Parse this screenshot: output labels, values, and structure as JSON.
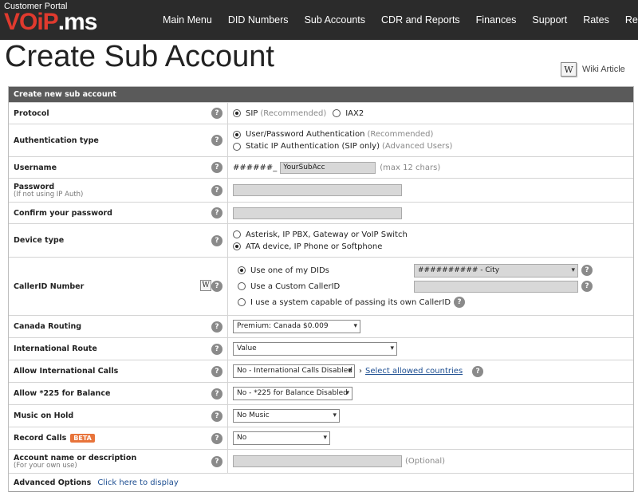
{
  "header": {
    "portal_label": "Customer Portal",
    "logo_voip": "VOiP",
    "logo_ms": ".ms",
    "nav": [
      "Main Menu",
      "DID Numbers",
      "Sub Accounts",
      "CDR and Reports",
      "Finances",
      "Support",
      "Rates",
      "Reseller"
    ]
  },
  "page": {
    "title": "Create Sub Account",
    "wiki_badge": "W",
    "wiki_text": "Wiki Article"
  },
  "form": {
    "heading": "Create new sub account",
    "help_glyph": "?",
    "protocol": {
      "label": "Protocol",
      "sip": "SIP",
      "sip_note": "(Recommended)",
      "iax": "IAX2"
    },
    "auth": {
      "label": "Authentication type",
      "opt1": "User/Password Authentication",
      "opt1_note": "(Recommended)",
      "opt2": "Static IP Authentication (SIP only)",
      "opt2_note": "(Advanced Users)"
    },
    "username": {
      "label": "Username",
      "prefix": "######_",
      "value": "YourSubAcc",
      "hint": "(max 12 chars)"
    },
    "password": {
      "label": "Password",
      "sub": "(If not using IP Auth)",
      "value": ""
    },
    "confirm": {
      "label": "Confirm your password",
      "value": ""
    },
    "device": {
      "label": "Device type",
      "opt1": "Asterisk, IP PBX, Gateway or VoIP Switch",
      "opt2": "ATA device, IP Phone or Softphone"
    },
    "callerid": {
      "label": "CallerID Number",
      "wiki_badge": "W",
      "opt1": "Use one of my DIDs",
      "did_value": "########## - City",
      "opt2": "Use a Custom CallerID",
      "custom_value": "",
      "opt3": "I use a system capable of passing its own CallerID"
    },
    "canada": {
      "label": "Canada Routing",
      "value": "Premium: Canada $0.009"
    },
    "intl_route": {
      "label": "International Route",
      "value": "Value"
    },
    "allow_intl": {
      "label": "Allow International Calls",
      "value": "No - International Calls Disabled",
      "link": "Select allowed countries",
      "arrow": "›"
    },
    "star225": {
      "label": "Allow *225 for Balance",
      "value": "No - *225 for Balance Disabled"
    },
    "moh": {
      "label": "Music on Hold",
      "value": "No Music"
    },
    "record": {
      "label": "Record Calls",
      "badge": "BETA",
      "value": "No"
    },
    "description": {
      "label": "Account name or description",
      "sub": "(For your own use)",
      "value": "",
      "hint": "(Optional)"
    },
    "advanced": {
      "label": "Advanced Options",
      "link": "Click here to display"
    }
  },
  "colors": {
    "nav_bg": "#2b2b2b",
    "logo_red": "#e03a2e",
    "header_bar": "#5a5a5a",
    "beta_orange": "#e8743b",
    "link_blue": "#1d4e91"
  }
}
